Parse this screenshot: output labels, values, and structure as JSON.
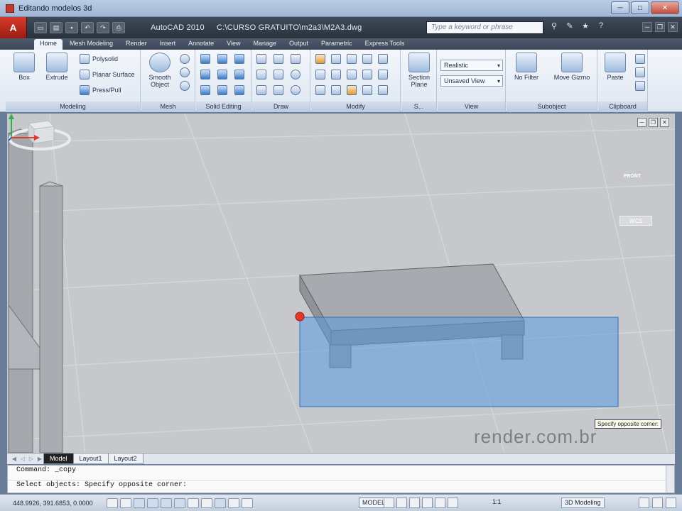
{
  "window": {
    "title": "Editando modelos 3d",
    "minimize": "─",
    "maximize": "□",
    "close": "✕"
  },
  "app": {
    "logo": "A",
    "name": "AutoCAD 2010",
    "file_path": "C:\\CURSO GRATUITO\\m2a3\\M2A3.dwg",
    "search_placeholder": "Type a keyword or phrase",
    "icons": [
      "binoculars-icon",
      "wrench-icon",
      "star-icon",
      "help-icon"
    ]
  },
  "ribbon_tabs": [
    "Home",
    "Mesh Modeling",
    "Render",
    "Insert",
    "Annotate",
    "View",
    "Manage",
    "Output",
    "Parametric",
    "Express Tools"
  ],
  "panels": {
    "modeling": {
      "title": "Modeling",
      "box": "Box",
      "extrude": "Extrude",
      "polysolid": "Polysolid",
      "planar_surface": "Planar Surface",
      "press_pull": "Press/Pull"
    },
    "mesh": {
      "title": "Mesh",
      "smooth_object": "Smooth Object"
    },
    "solid_editing": {
      "title": "Solid Editing"
    },
    "draw": {
      "title": "Draw"
    },
    "modify": {
      "title": "Modify"
    },
    "section": {
      "title": "S...",
      "section_plane": "Section Plane"
    },
    "view": {
      "title": "View",
      "visual_style": "Realistic",
      "named_view": "Unsaved View"
    },
    "subobject": {
      "title": "Subobject",
      "no_filter": "No Filter",
      "move_gizmo": "Move Gizmo"
    },
    "clipboard": {
      "title": "Clipboard",
      "paste": "Paste"
    }
  },
  "viewport": {
    "viewcube_face": "FRONT",
    "wcs": "WCS",
    "tooltip": "Specify opposite corner:",
    "watermark": "render.com.br"
  },
  "layout_tabs": [
    "Model",
    "Layout1",
    "Layout2"
  ],
  "command": {
    "line1": "Command:  _copy",
    "line2": "Select objects: Specify opposite corner:"
  },
  "status": {
    "coordinates": "448.9926, 391.6853, 0.0000",
    "model": "MODEL",
    "scale": "1:1",
    "workspace": "3D Modeling"
  },
  "colors": {
    "accent": "#c03a2b",
    "selection": "#5b9ae0",
    "grip": "#e8372a"
  }
}
